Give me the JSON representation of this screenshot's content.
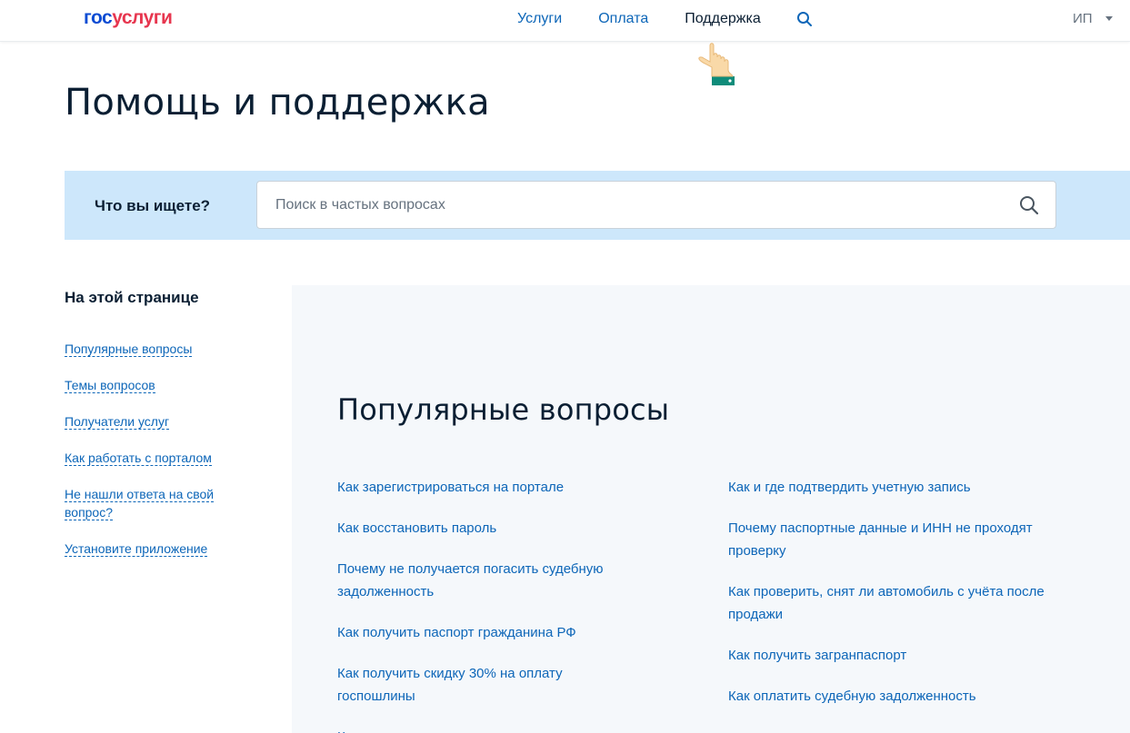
{
  "header": {
    "logo_part1": "гос",
    "logo_part2": "услуги",
    "nav": [
      "Услуги",
      "Оплата",
      "Поддержка"
    ],
    "active_nav": "Поддержка",
    "user_label": "ИП"
  },
  "page_title": "Помощь и поддержка",
  "search": {
    "label": "Что вы ищете?",
    "placeholder": "Поиск в частых вопросах"
  },
  "toc": {
    "title": "На этой странице",
    "items": [
      "Популярные вопросы",
      "Темы вопросов",
      "Получатели услуг",
      "Как работать с порталом",
      "Не нашли ответа на свой вопрос?",
      "Установите приложение"
    ]
  },
  "popular": {
    "title": "Популярные вопросы",
    "left": [
      "Как зарегистрироваться на портале",
      "Как восстановить пароль",
      "Почему не получается погасить судебную задолженность",
      "Как получить паспорт гражданина РФ",
      "Как получить скидку 30% на оплату госпошлины",
      "Как узнать о пенсионных накоплениях"
    ],
    "right": [
      "Как и где подтвердить учетную запись",
      "Почему паспортные данные и ИНН не проходят проверку",
      "Как проверить, снят ли автомобиль с учёта после продажи",
      "Как получить загранпаспорт",
      "Как оплатить судебную задолженность"
    ]
  },
  "colors": {
    "brand_blue": "#0d4cd3",
    "brand_red": "#e7364f",
    "link": "#0d66b8",
    "search_band": "#cde7fb",
    "content_bg": "#f5f8fb"
  }
}
